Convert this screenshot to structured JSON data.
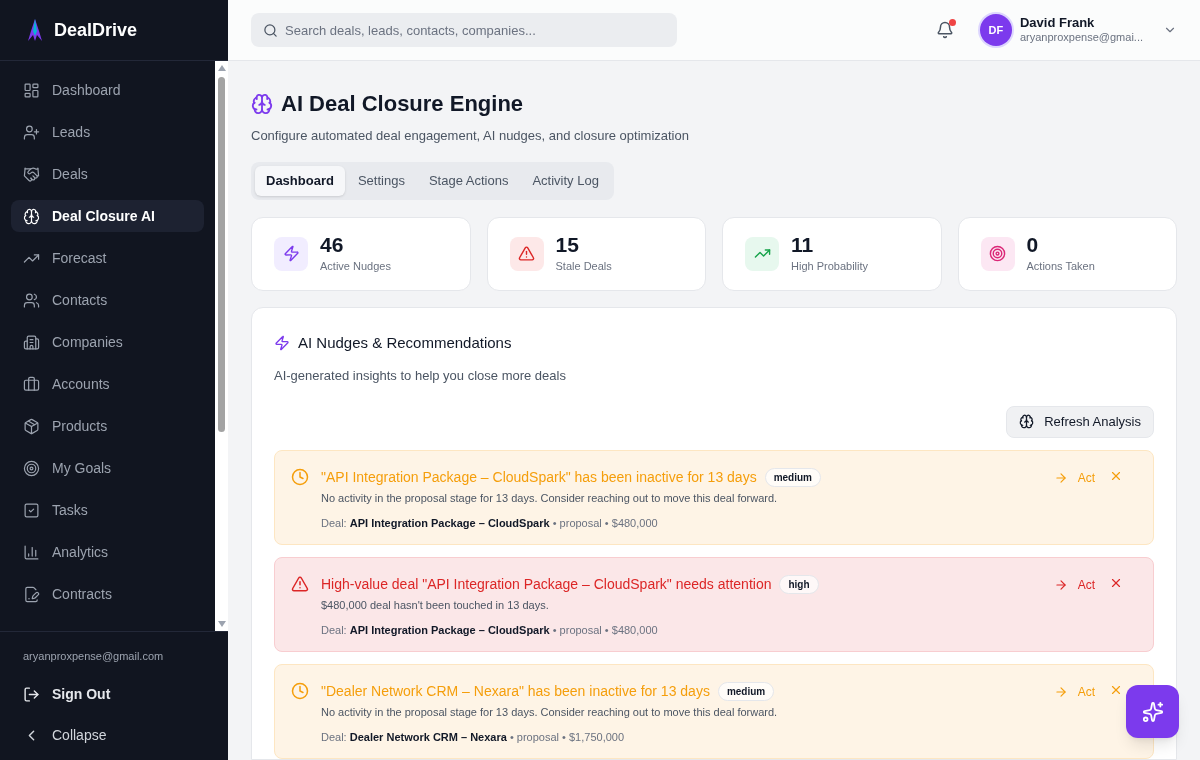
{
  "brand": {
    "name": "DealDrive"
  },
  "sidebar": {
    "items": [
      {
        "label": "Dashboard",
        "selected": false
      },
      {
        "label": "Leads",
        "selected": false
      },
      {
        "label": "Deals",
        "selected": false
      },
      {
        "label": "Deal Closure AI",
        "selected": true
      },
      {
        "label": "Forecast",
        "selected": false
      },
      {
        "label": "Contacts",
        "selected": false
      },
      {
        "label": "Companies",
        "selected": false
      },
      {
        "label": "Accounts",
        "selected": false
      },
      {
        "label": "Products",
        "selected": false
      },
      {
        "label": "My Goals",
        "selected": false
      },
      {
        "label": "Tasks",
        "selected": false
      },
      {
        "label": "Analytics",
        "selected": false
      },
      {
        "label": "Contracts",
        "selected": false
      }
    ],
    "account_email": "aryanproxpense@gmail.com",
    "sign_out": "Sign Out",
    "collapse": "Collapse"
  },
  "header": {
    "search": {
      "placeholder": "Search deals, leads, contacts, companies..."
    },
    "notifications": {
      "unread": true
    },
    "user": {
      "initials": "DF",
      "name": "David Frank",
      "email": "aryanproxpense@gmai..."
    }
  },
  "page": {
    "title": "AI Deal Closure Engine",
    "subtitle": "Configure automated deal engagement, AI nudges, and closure optimization"
  },
  "tabs": [
    {
      "label": "Dashboard",
      "selected": true
    },
    {
      "label": "Settings",
      "selected": false
    },
    {
      "label": "Stage Actions",
      "selected": false
    },
    {
      "label": "Activity Log",
      "selected": false
    }
  ],
  "stats": [
    {
      "kind": "nudges",
      "value": "46",
      "label": "Active Nudges"
    },
    {
      "kind": "stale",
      "value": "15",
      "label": "Stale Deals"
    },
    {
      "kind": "probability",
      "value": "11",
      "label": "High Probability"
    },
    {
      "kind": "actions",
      "value": "0",
      "label": "Actions Taken"
    }
  ],
  "nudges_panel": {
    "title": "AI Nudges & Recommendations",
    "subtitle": "AI-generated insights to help you close more deals",
    "refresh_button": "Refresh Analysis",
    "nudges": [
      {
        "kind": "inactive",
        "title": "\"API Integration Package – CloudSpark\" has been inactive for 13 days",
        "priority": "medium",
        "description": "No activity in the proposal stage for 13 days. Consider reaching out to move this deal forward.",
        "deal_line": "Deal: **API Integration Package – CloudSpark** • proposal • $480,000",
        "act": "Act"
      },
      {
        "kind": "high_value",
        "title": "High-value deal \"API Integration Package – CloudSpark\" needs attention",
        "priority": "high",
        "description": "$480,000 deal hasn't been touched in 13 days.",
        "deal_line": "Deal: **API Integration Package – CloudSpark** • proposal • $480,000",
        "act": "Act"
      },
      {
        "kind": "inactive",
        "title": "\"Dealer Network CRM – Nexara\" has been inactive for 13 days",
        "priority": "medium",
        "description": "No activity in the proposal stage for 13 days. Consider reaching out to move this deal forward.",
        "deal_line": "Deal: **Dealer Network CRM – Nexara** • proposal • $1,750,000",
        "act": "Act"
      }
    ]
  }
}
